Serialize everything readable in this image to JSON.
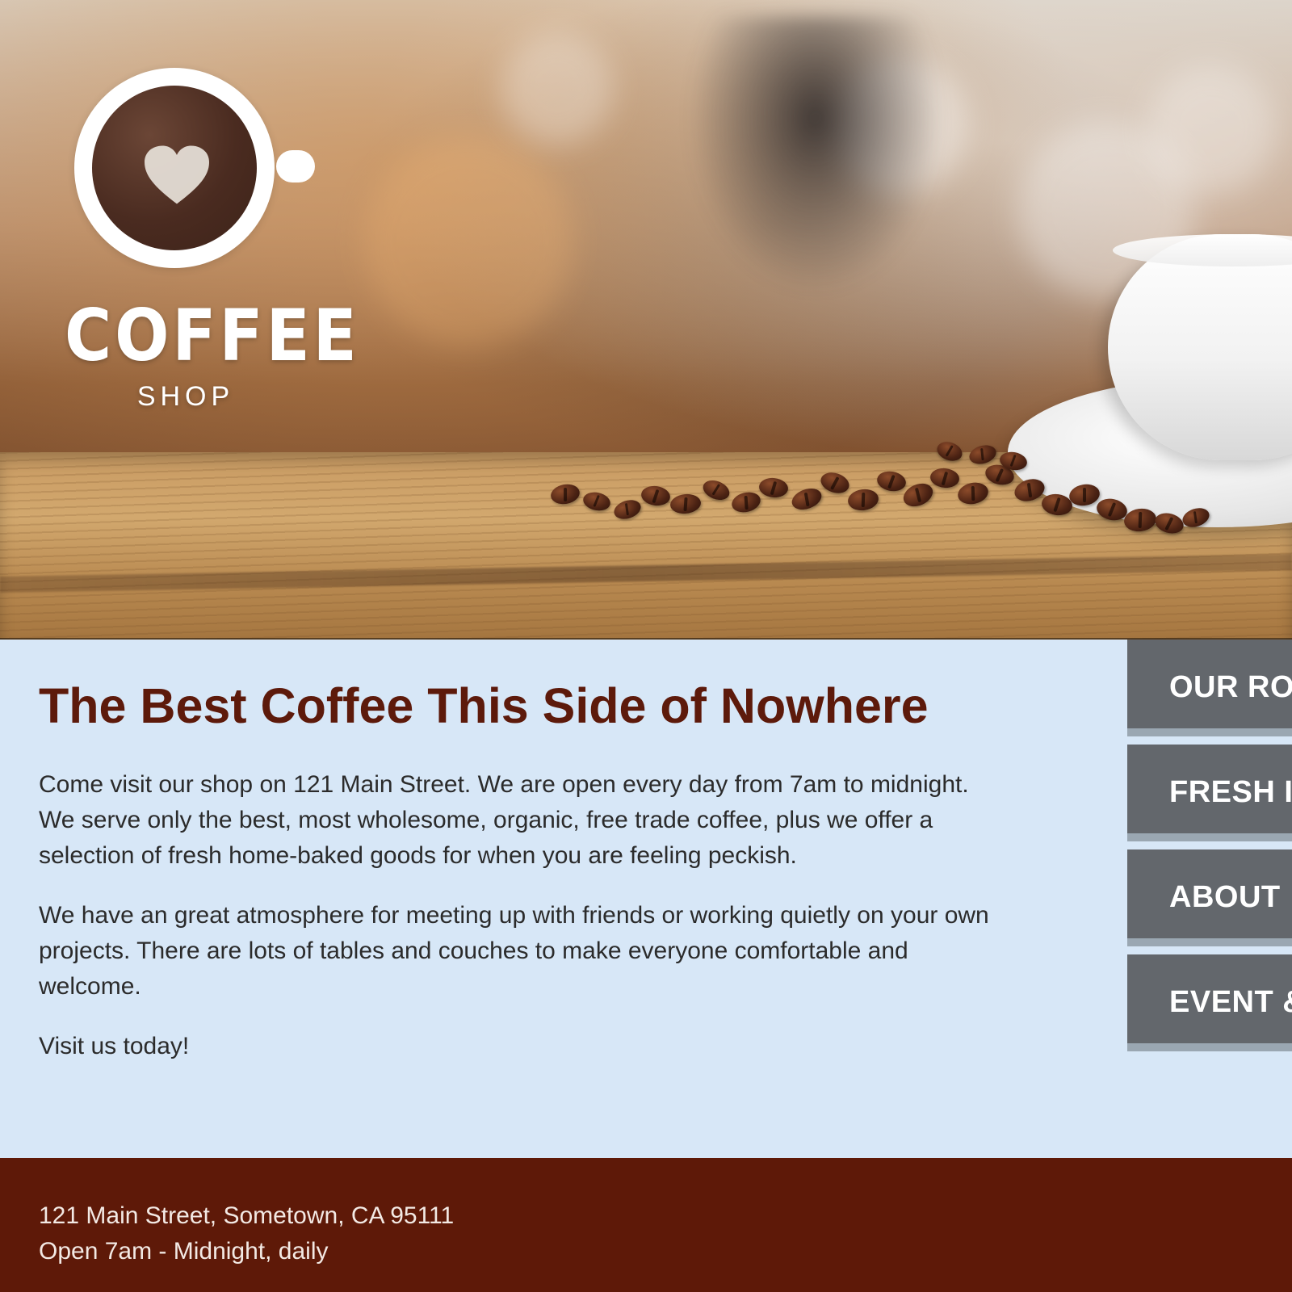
{
  "brand": {
    "logo": {
      "title": "COFFEE",
      "subtitle": "SHOP",
      "icon": "heart-icon"
    }
  },
  "main": {
    "headline": "The Best Coffee This Side of Nowhere",
    "paragraphs": [
      "Come visit our shop on 121 Main Street. We are open every day from 7am to midnight. We serve only the best, most wholesome, organic, free trade coffee, plus we offer a selection of fresh home-baked goods for when you are feeling peckish.",
      "We have an great atmosphere for meeting up with friends or working quietly on your own projects. There are lots of tables and couches to make everyone comfortable and welcome.",
      "Visit us today!"
    ]
  },
  "nav": {
    "items": [
      {
        "label": "OUR RO"
      },
      {
        "label": "FRESH I"
      },
      {
        "label": "ABOUT"
      },
      {
        "label": "EVENT &"
      }
    ]
  },
  "footer": {
    "address": "121 Main Street, Sometown, CA 95111",
    "hours": "Open 7am - Midnight, daily"
  },
  "colors": {
    "headline": "#5d1a0b",
    "body_bg": "#d7e7f7",
    "nav_bg": "#63676c",
    "nav_divider": "#9aa7b2",
    "footer_bg": "#5e1908",
    "footer_text": "#f3e9e4"
  }
}
